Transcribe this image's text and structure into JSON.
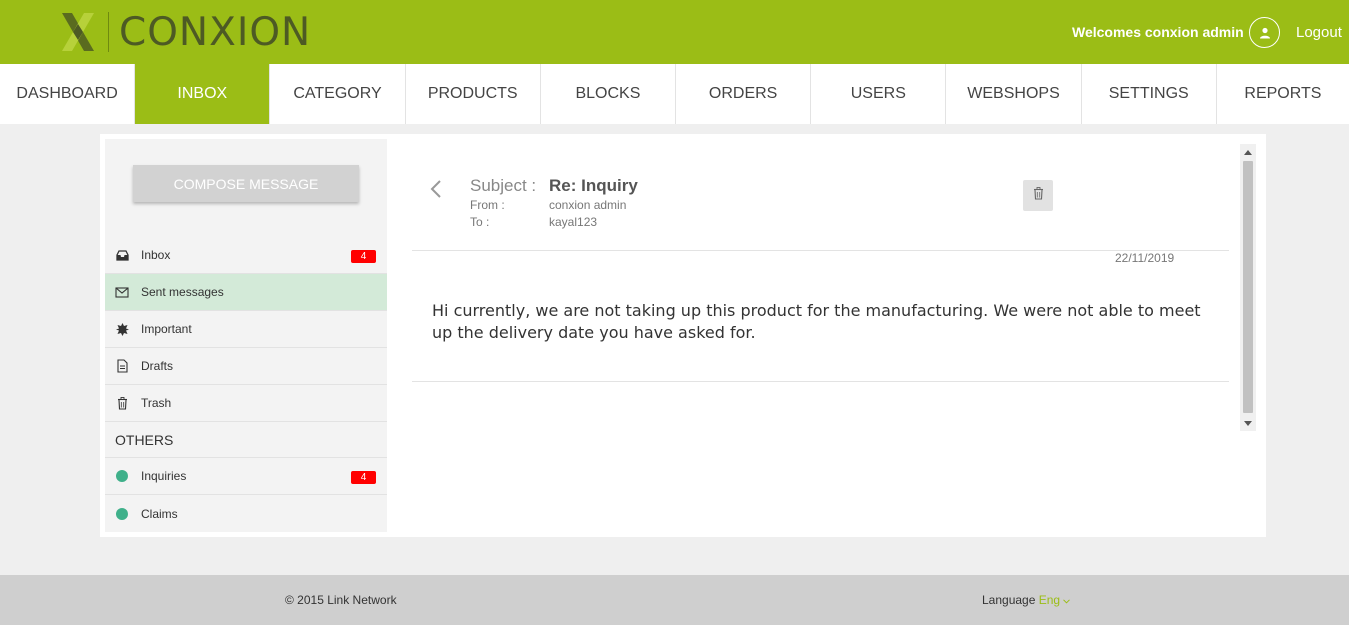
{
  "brand": {
    "name": "CONXION"
  },
  "header": {
    "welcome": "Welcomes conxion admin",
    "logout": "Logout"
  },
  "nav": [
    {
      "label": "DASHBOARD"
    },
    {
      "label": "INBOX"
    },
    {
      "label": "CATEGORY"
    },
    {
      "label": "PRODUCTS"
    },
    {
      "label": "BLOCKS"
    },
    {
      "label": "ORDERS"
    },
    {
      "label": "USERS"
    },
    {
      "label": "WEBSHOPS"
    },
    {
      "label": "SETTINGS"
    },
    {
      "label": "REPORTS"
    }
  ],
  "sidebar": {
    "compose": "COMPOSE MESSAGE",
    "folders": [
      {
        "label": "Inbox",
        "count": "4",
        "icon": "inbox-tray-icon"
      },
      {
        "label": "Sent messages",
        "icon": "envelope-icon"
      },
      {
        "label": "Important",
        "icon": "star-burst-icon"
      },
      {
        "label": "Drafts",
        "icon": "document-icon"
      },
      {
        "label": "Trash",
        "icon": "trash-icon"
      }
    ],
    "others_label": "OTHERS",
    "others": [
      {
        "label": "Inquiries",
        "count": "4"
      },
      {
        "label": "Claims"
      }
    ]
  },
  "message": {
    "subject_label": "Subject :",
    "subject": "Re: Inquiry",
    "from_label": "From :",
    "from": "conxion admin",
    "to_label": "To :",
    "to": "kayal123",
    "date": "22/11/2019",
    "body": "Hi currently, we are not taking up this product for the manufacturing. We were not able to meet up the delivery date you have asked for."
  },
  "footer": {
    "copyright": "© 2015 Link Network",
    "language_label": "Language",
    "language_value": "Eng"
  },
  "colors": {
    "brand_green": "#9bbd16",
    "badge_red": "#ff0000",
    "dot_green": "#3fb08a",
    "active_folder": "#d3ead8"
  }
}
